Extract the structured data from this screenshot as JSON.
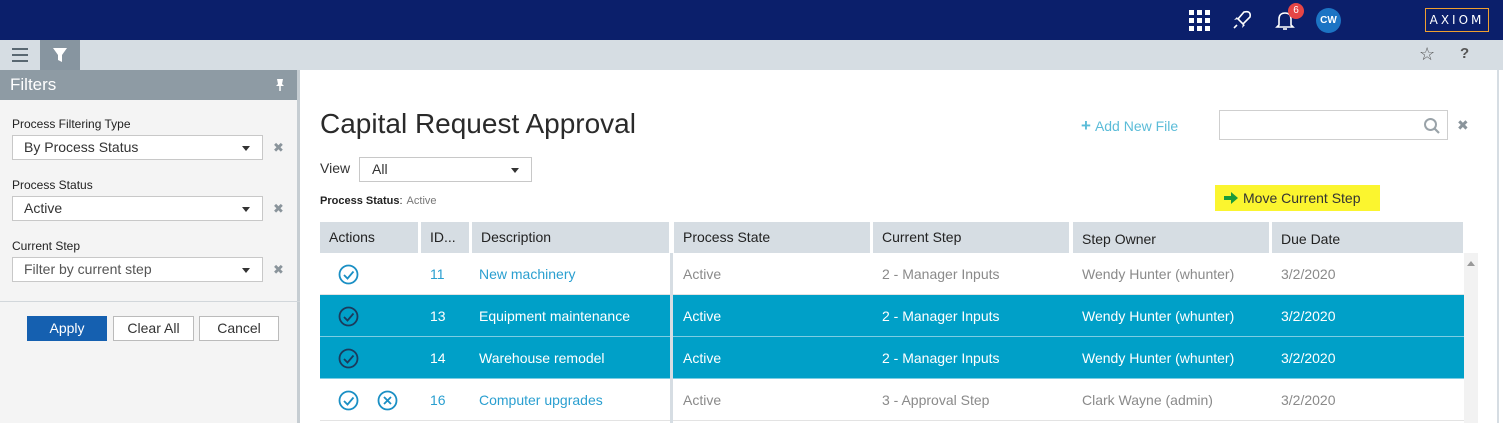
{
  "topbar": {
    "apps_icon": "apps-grid-icon",
    "rocket_icon": "rocket-icon",
    "bell_icon": "bell-icon",
    "notification_count": "6",
    "avatar_initials": "CW",
    "logo": "AXIOM"
  },
  "subbar": {
    "menu_icon": "hamburger-menu-icon",
    "filter_icon": "funnel-icon",
    "star_icon": "star-icon",
    "help_label": "?"
  },
  "filters": {
    "title": "Filters",
    "fields": [
      {
        "label": "Process Filtering Type",
        "value": "By Process Status",
        "placeholder": ""
      },
      {
        "label": "Process Status",
        "value": "Active",
        "placeholder": ""
      },
      {
        "label": "Current Step",
        "value": "",
        "placeholder": "Filter by current step"
      }
    ],
    "clear_glyph": "✖",
    "apply_label": "Apply",
    "clear_all_label": "Clear All",
    "cancel_label": "Cancel"
  },
  "main": {
    "title": "Capital Request Approval",
    "add_new_file": "Add New File",
    "add_icon": "+",
    "search_value": "",
    "view_label": "View",
    "view_value": "All",
    "status_label": "Process Status",
    "status_value": "Active",
    "move_step_label": "Move Current Step"
  },
  "table": {
    "columns": [
      "Actions",
      "ID...",
      "Description",
      "Process State",
      "Current Step",
      "Step Owner",
      "Due Date"
    ],
    "rows": [
      {
        "actions": [
          "approve"
        ],
        "id": "11",
        "description": "New machinery",
        "state": "Active",
        "step": "2 - Manager Inputs",
        "owner": "Wendy Hunter (whunter)",
        "due": "3/2/2020",
        "selected": false
      },
      {
        "actions": [
          "approve"
        ],
        "id": "13",
        "description": "Equipment maintenance",
        "state": "Active",
        "step": "2 - Manager Inputs",
        "owner": "Wendy Hunter (whunter)",
        "due": "3/2/2020",
        "selected": true
      },
      {
        "actions": [
          "approve"
        ],
        "id": "14",
        "description": "Warehouse remodel",
        "state": "Active",
        "step": "2 - Manager Inputs",
        "owner": "Wendy Hunter (whunter)",
        "due": "3/2/2020",
        "selected": true
      },
      {
        "actions": [
          "approve",
          "reject"
        ],
        "id": "16",
        "description": "Computer upgrades",
        "state": "Active",
        "step": "3 - Approval Step",
        "owner": "Clark Wayne (admin)",
        "due": "3/2/2020",
        "selected": false
      }
    ]
  },
  "colors": {
    "topbar": "#0b1f6b",
    "selected_row": "#00a0c8",
    "link": "#2a9fd0",
    "apply_button": "#1560b0",
    "highlight_button": "#fbf52f"
  }
}
